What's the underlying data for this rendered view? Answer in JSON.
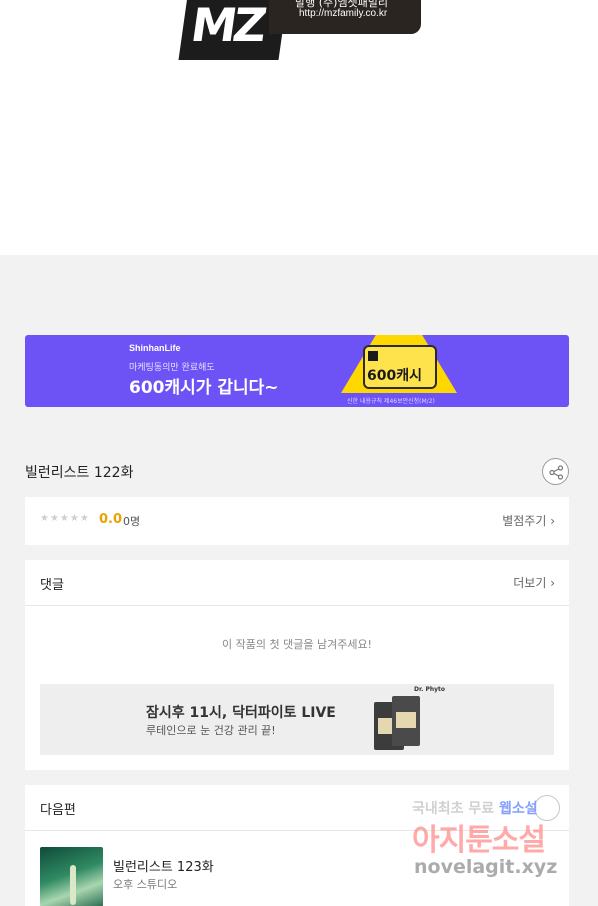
{
  "logo": {
    "mark": "MZ",
    "company": "발행 (주)엠젯패밀리",
    "url": "http://mzfamily.co.kr"
  },
  "banner": {
    "brand": "ShinhanLife",
    "sub": "마케팅동의만 완료해도",
    "headline": "600캐시가 갑니다~",
    "cash": "600캐시",
    "fine": "신한 내용규칙 제46보안신청(M/2)"
  },
  "episode": {
    "title": "빌런리스트 122화"
  },
  "rating": {
    "stars": "★★★★★",
    "score": "0.0",
    "voters": "0명",
    "rate_label": "별점주기 ›"
  },
  "comments": {
    "label": "댓글",
    "more": "더보기 ›",
    "empty": "이 작품의 첫 댓글을 남겨주세요!",
    "ad": {
      "brand": "Dr. Phyto",
      "title": "잠시후 11시, 닥터파이토 LIVE",
      "sub": "루테인으로 눈 건강 관리 끝!"
    }
  },
  "next": {
    "label": "다음편",
    "title": "빌런리스트 123화",
    "author": "오후 스튜디오"
  },
  "watermark": {
    "line1a": "국내최초 무료 ",
    "line1b": "웹소설",
    "line2": "아지툰소설",
    "line3": "novelagit.xyz"
  }
}
